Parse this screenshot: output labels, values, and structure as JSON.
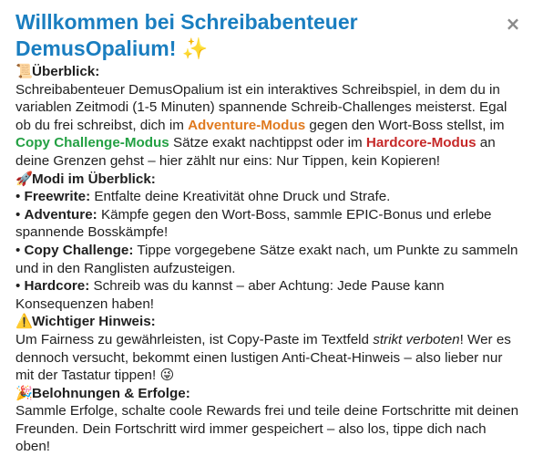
{
  "dialog": {
    "title_line1": "Willkommen bei Schreibabenteuer",
    "title_line2": "DemusOpalium!",
    "title_emoji": "✨",
    "close_label": "×"
  },
  "overview": {
    "icon": "scroll-icon",
    "icon_glyph": "📜",
    "heading": "Überblick:",
    "text_a": "Schreibabenteuer DemusOpalium ist ein interaktives Schreibspiel, in dem du in variablen Zeitmodi (1-5 Minuten) spannende Schreib-Challenges meisterst. Egal ob du frei schreibst, dich im ",
    "adventure_mode": "Adventure-Modus",
    "text_b": " gegen den Wort-Boss stellst, im ",
    "copy_mode": "Copy Challenge-Modus",
    "text_c": " Sätze exakt nachtippst oder im ",
    "hardcore_mode": "Hardcore-Modus",
    "text_d": " an deine Grenzen gehst – hier zählt nur eins: Nur Tippen, kein Kopieren!"
  },
  "modes": {
    "icon": "rocket-icon",
    "icon_glyph": "🚀",
    "heading": "Modi im Überblick:",
    "items": [
      {
        "name": "Freewrite:",
        "desc": " Entfalte deine Kreativität ohne Druck und Strafe."
      },
      {
        "name": "Adventure:",
        "desc": " Kämpfe gegen den Wort-Boss, sammle EPIC-Bonus und erlebe spannende Bosskämpfe!"
      },
      {
        "name": "Copy Challenge:",
        "desc": " Tippe vorgegebene Sätze exakt nach, um Punkte zu sammeln und in den Ranglisten aufzusteigen."
      },
      {
        "name": "Hardcore:",
        "desc": " Schreib was du kannst – aber Achtung: Jede Pause kann Konsequenzen haben!"
      }
    ]
  },
  "warning": {
    "icon": "warning-icon",
    "icon_glyph": "⚠️",
    "heading": "Wichtiger Hinweis:",
    "text_a": "Um Fairness zu gewährleisten, ist Copy-Paste im Textfeld ",
    "emphasis": "strikt verboten",
    "text_b": "! Wer es dennoch versucht, bekommt einen lustigen Anti-Cheat-Hinweis – also lieber nur mit der Tastatur tippen! ",
    "end_emoji": "😜"
  },
  "rewards": {
    "icon": "party-popper-icon",
    "icon_glyph": "🎉",
    "heading": "Belohnungen & Erfolge:",
    "text": "Sammle Erfolge, schalte coole Rewards frei und teile deine Fortschritte mit deinen Freunden. Dein Fortschritt wird immer gespeichert – also los, tippe dich nach oben!"
  },
  "colors": {
    "title": "#1a7ec0",
    "adventure": "#e07a1f",
    "copy": "#23a043",
    "hardcore": "#c62828"
  }
}
